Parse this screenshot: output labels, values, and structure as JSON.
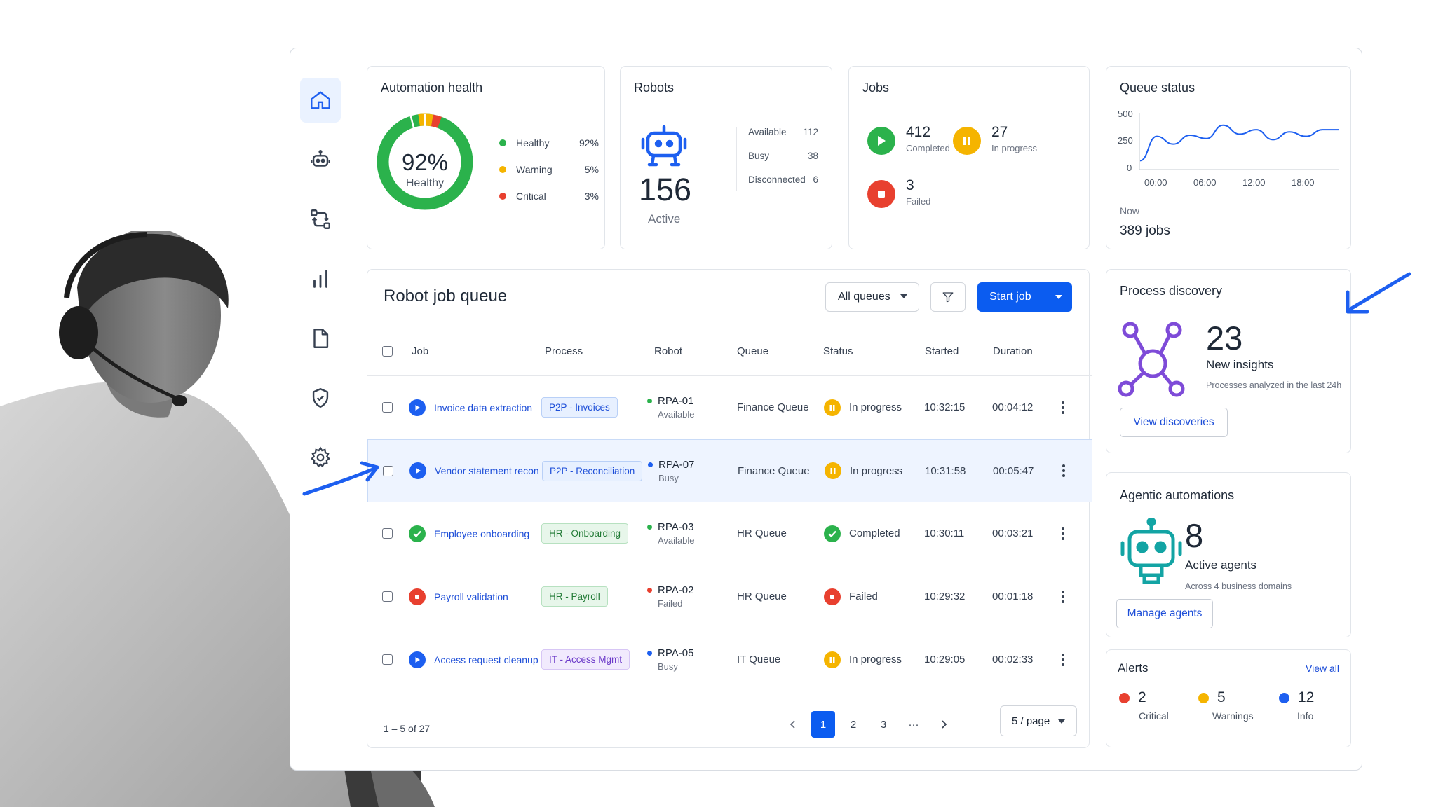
{
  "sidebar": {
    "items": [
      {
        "name": "home",
        "icon": "home-icon",
        "active": true
      },
      {
        "name": "robots",
        "icon": "robot-icon"
      },
      {
        "name": "processes",
        "icon": "workflow-icon"
      },
      {
        "name": "analytics",
        "icon": "bar-chart-icon"
      },
      {
        "name": "documents",
        "icon": "document-icon"
      },
      {
        "name": "security",
        "icon": "shield-check-icon"
      },
      {
        "name": "settings",
        "icon": "gear-icon"
      }
    ]
  },
  "health": {
    "title": "Automation health",
    "pct": "92%",
    "sub": "Healthy",
    "legend": [
      {
        "label": "Healthy",
        "value": "92%",
        "color": "#2bb24c"
      },
      {
        "label": "Warning",
        "value": "5%",
        "color": "#f5b400"
      },
      {
        "label": "Critical",
        "value": "3%",
        "color": "#e8402f"
      }
    ]
  },
  "robots": {
    "title": "Robots",
    "count": "156",
    "sub": "Active",
    "stats": [
      {
        "label": "Available",
        "value": "112"
      },
      {
        "label": "Busy",
        "value": "38"
      },
      {
        "label": "Disconnected",
        "value": "6"
      }
    ]
  },
  "jobs": {
    "title": "Jobs",
    "completed": {
      "num": "412",
      "label": "Completed"
    },
    "in_progress": {
      "num": "27",
      "label": "In progress"
    },
    "failed": {
      "num": "3",
      "label": "Failed"
    }
  },
  "queue": {
    "title": "Queue status",
    "y_ticks": [
      "500",
      "250",
      "0"
    ],
    "x_ticks": [
      "00:00",
      "06:00",
      "12:00",
      "18:00"
    ],
    "now_label": "Now",
    "now_value": "389 jobs"
  },
  "chart_data": {
    "type": "line",
    "title": "Queue status",
    "xlabel": "",
    "ylabel": "",
    "ylim": [
      0,
      500
    ],
    "x": [
      "00:00",
      "02:00",
      "04:00",
      "06:00",
      "08:00",
      "10:00",
      "12:00",
      "14:00",
      "16:00",
      "18:00",
      "20:00",
      "22:00",
      "24:00"
    ],
    "values": [
      80,
      300,
      230,
      310,
      280,
      400,
      320,
      360,
      270,
      340,
      300,
      360,
      360
    ],
    "grid": false
  },
  "job_queue": {
    "title": "Robot job queue",
    "filter_value": "All queues",
    "start_label": "Start job",
    "columns": [
      "Job",
      "Process",
      "Robot",
      "Queue",
      "Status",
      "Started",
      "Duration"
    ],
    "rows": [
      {
        "job": "Invoice data extraction",
        "job_status": "running",
        "process": "P2P - Invoices",
        "tag": "blue",
        "robot": "RPA-01",
        "robot_state": "Available",
        "robot_dot": "#2bb24c",
        "queue": "Finance Queue",
        "status": "In progress",
        "status_kind": "progress",
        "started": "10:32:15",
        "duration": "00:04:12"
      },
      {
        "job": "Vendor statement recon",
        "job_status": "running",
        "process": "P2P - Reconciliation",
        "tag": "blue",
        "robot": "RPA-07",
        "robot_state": "Busy",
        "robot_dot": "#1d5ff0",
        "queue": "Finance Queue",
        "status": "In progress",
        "status_kind": "progress",
        "started": "10:31:58",
        "duration": "00:05:47"
      },
      {
        "job": "Employee onboarding",
        "job_status": "done",
        "process": "HR - Onboarding",
        "tag": "green",
        "robot": "RPA-03",
        "robot_state": "Available",
        "robot_dot": "#2bb24c",
        "queue": "HR Queue",
        "status": "Completed",
        "status_kind": "done",
        "started": "10:30:11",
        "duration": "00:03:21"
      },
      {
        "job": "Payroll validation",
        "job_status": "failed",
        "process": "HR - Payroll",
        "tag": "green",
        "robot": "RPA-02",
        "robot_state": "Failed",
        "robot_dot": "#e8402f",
        "queue": "HR Queue",
        "status": "Failed",
        "status_kind": "failed",
        "started": "10:29:32",
        "duration": "00:01:18"
      },
      {
        "job": "Access request cleanup",
        "job_status": "running",
        "process": "IT - Access Mgmt",
        "tag": "purple",
        "robot": "RPA-05",
        "robot_state": "Busy",
        "robot_dot": "#1d5ff0",
        "queue": "IT Queue",
        "status": "In progress",
        "status_kind": "progress",
        "started": "10:29:05",
        "duration": "00:02:33"
      }
    ],
    "range": "1 – 5 of 27",
    "pages": [
      "1",
      "2",
      "3",
      "···"
    ],
    "active_page": "1",
    "per_page": "5 / page"
  },
  "discovery": {
    "title": "Process discovery",
    "num": "23",
    "sub": "New insights",
    "note": "Processes analyzed in the last 24h",
    "button": "View discoveries"
  },
  "agentic": {
    "title": "Agentic automations",
    "num": "8",
    "sub": "Active agents",
    "note": "Across 4 business domains",
    "button": "Manage agents"
  },
  "alerts": {
    "title": "Alerts",
    "link": "View all",
    "items": [
      {
        "num": "2",
        "label": "Critical",
        "color": "#e8402f"
      },
      {
        "num": "5",
        "label": "Warnings",
        "color": "#f5b400"
      },
      {
        "num": "12",
        "label": "Info",
        "color": "#1d5ff0"
      }
    ]
  }
}
